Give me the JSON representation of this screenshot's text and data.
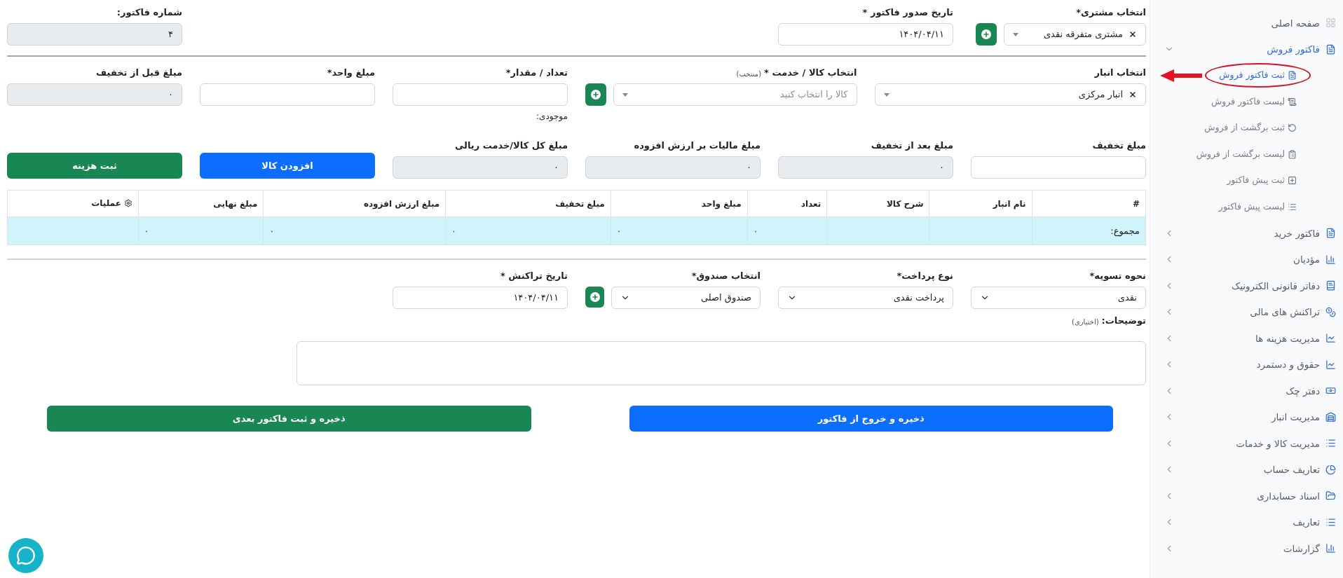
{
  "sidebar": {
    "items": [
      {
        "label": "صفحه اصلی"
      },
      {
        "label": "فاکتور فروش",
        "expanded": true,
        "children": [
          {
            "label": "ثبت فاکتور فروش",
            "selected": true
          },
          {
            "label": "لیست فاکتور فروش",
            "selected": false
          },
          {
            "label": "ثبت برگشت از فروش",
            "selected": false
          },
          {
            "label": "لیست برگشت از فروش",
            "selected": false
          },
          {
            "label": "ثبت پیش فاکتور",
            "selected": false
          },
          {
            "label": "لیست پیش فاکتور",
            "selected": false
          }
        ]
      },
      {
        "label": "فاکتور خرید",
        "expanded": false
      },
      {
        "label": "مؤدیان",
        "expanded": false
      },
      {
        "label": "دفاتر قانونی الکترونیک",
        "expanded": false
      },
      {
        "label": "تراکنش های مالی",
        "expanded": false
      },
      {
        "label": "مدیریت هزینه ها",
        "expanded": false
      },
      {
        "label": "حقوق و دستمرد",
        "expanded": false
      },
      {
        "label": "دفتر چک",
        "expanded": false
      },
      {
        "label": "مدیریت انبار",
        "expanded": false
      },
      {
        "label": "مدیریت کالا و خدمات",
        "expanded": false
      },
      {
        "label": "تعاریف حساب",
        "expanded": false
      },
      {
        "label": "اسناد حسابداری",
        "expanded": false
      },
      {
        "label": "تعاریف",
        "expanded": false
      },
      {
        "label": "گزارشات",
        "expanded": false
      }
    ]
  },
  "header": {
    "customer": {
      "label": "انتخاب مشتری*",
      "value": "مشتری متفرقه نقدی"
    },
    "issue_date": {
      "label": "تاریخ صدور فاکتور *",
      "value": "۱۴۰۴/۰۴/۱۱"
    },
    "invoice_number": {
      "label": "شماره فاکتور:",
      "value": "۴"
    }
  },
  "item_entry": {
    "warehouse": {
      "label": "انتخاب انبار",
      "value": "انبار مرکزی"
    },
    "product": {
      "label": "انتخاب کالا / خدمت *",
      "note": "(منتخب)",
      "placeholder": "کالا را انتخاب کنید"
    },
    "quantity": {
      "label": "تعداد / مقدار*",
      "hint": "موجودی:"
    },
    "unit_price": {
      "label": "مبلغ واحد*"
    },
    "before_discount": {
      "label": "مبلغ قبل از تخفیف",
      "value": "۰"
    },
    "discount": {
      "label": "مبلغ تخفیف"
    },
    "after_discount": {
      "label": "مبلغ بعد از تخفیف",
      "value": "۰"
    },
    "vat": {
      "label": "مبلغ مالیات بر ارزش افزوده",
      "value": "۰"
    },
    "total": {
      "label": "مبلغ کل کالا/خدمت ریالی",
      "value": "۰"
    },
    "buttons": [
      {
        "label": "افزودن کالا",
        "kind": "primary"
      },
      {
        "label": "ثبت هزینه",
        "kind": "success"
      }
    ]
  },
  "table": {
    "columns": [
      "#",
      "نام انبار",
      "شرح کالا",
      "تعداد",
      "مبلغ واحد",
      "مبلغ تخفیف",
      "مبلغ ارزش افزوده",
      "مبلغ نهایی",
      "عملیات"
    ],
    "total_row": {
      "label": "مجموع:",
      "quantity": "۰",
      "unit_price": "۰",
      "discount": "۰",
      "vat": "۰",
      "final_amount": "۰"
    }
  },
  "payment": {
    "settlement": {
      "label": "نحوه تسویه*",
      "value": "نقدی"
    },
    "payment_type": {
      "label": "نوع پرداخت*",
      "value": "پرداخت نقدی"
    },
    "cash_box": {
      "label": "انتخاب صندوق*",
      "value": "صندوق اصلی"
    },
    "transaction_date": {
      "label": "تاریخ تراکنش *",
      "value": "۱۴۰۴/۰۴/۱۱"
    },
    "description": {
      "label": "توضیحات:",
      "note": "(اختیاری)"
    }
  },
  "actions": [
    {
      "label": "ذخیره و خروج از فاکتور",
      "kind": "primary"
    },
    {
      "label": "ذخیره و ثبت فاکتور بعدی",
      "kind": "success"
    }
  ]
}
